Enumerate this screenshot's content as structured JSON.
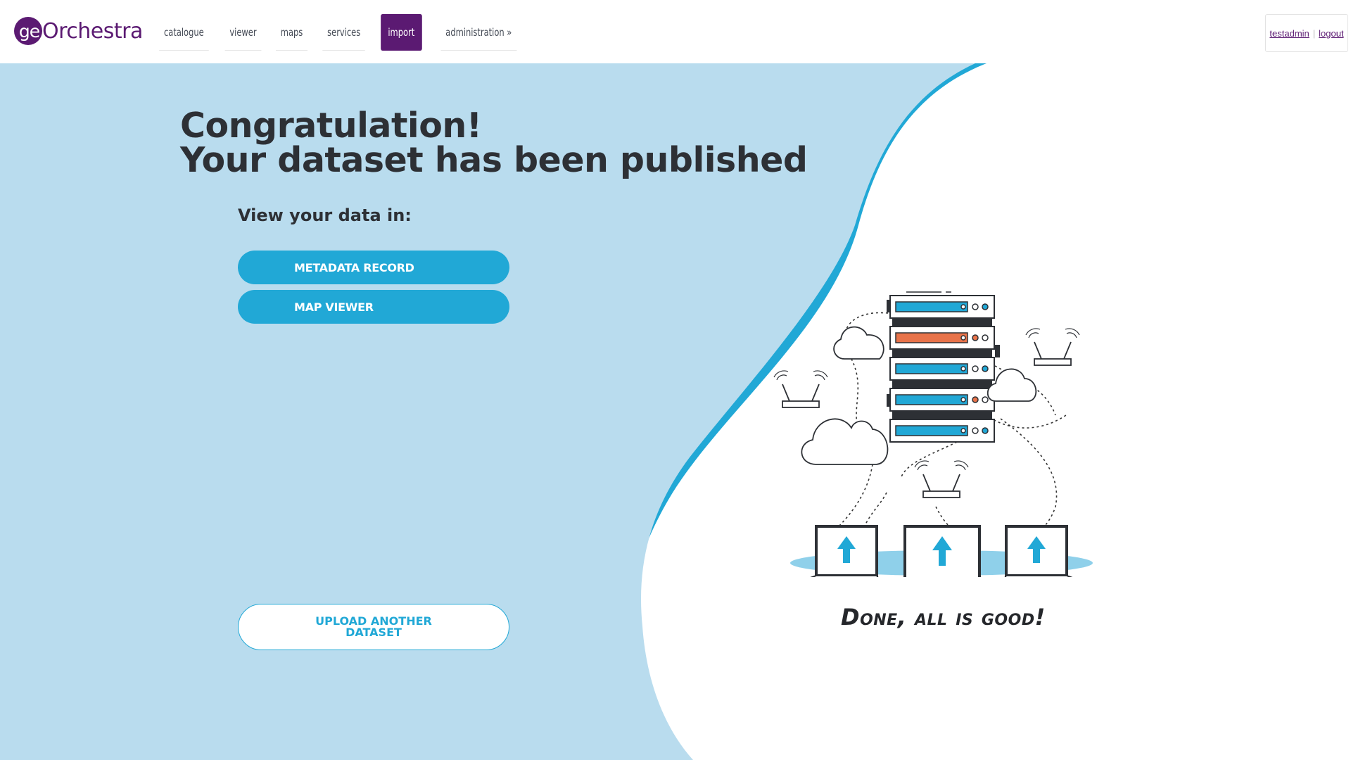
{
  "brand": {
    "logo_mark": "ge",
    "logo_word": "Orchestra",
    "color": "#5b1a72"
  },
  "nav": {
    "items": [
      {
        "label": "catalogue",
        "active": false
      },
      {
        "label": "viewer",
        "active": false
      },
      {
        "label": "maps",
        "active": false
      },
      {
        "label": "services",
        "active": false
      },
      {
        "label": "import",
        "active": true
      },
      {
        "label": "administration »",
        "active": false
      }
    ]
  },
  "user": {
    "username": "testadmin",
    "separator": "|",
    "logout_label": "logout"
  },
  "main": {
    "title_line1": "Congratulation!",
    "title_line2": "Your dataset has been published",
    "subtitle": "View your data in:",
    "buttons": {
      "metadata_record": "METADATA RECORD",
      "map_viewer": "MAP VIEWER",
      "upload_another": "UPLOAD ANOTHER DATASET"
    },
    "status_message": "Done, all is good!"
  },
  "colors": {
    "accent": "#21a8d6",
    "panel_bg": "#b9dcee",
    "text_dark": "#2d3035",
    "alert_orange": "#e8734a"
  },
  "icons": [
    "server-rack-icon",
    "cloud-icon",
    "wifi-router-icon",
    "laptop-upload-icon",
    "upload-arrow-icon"
  ]
}
